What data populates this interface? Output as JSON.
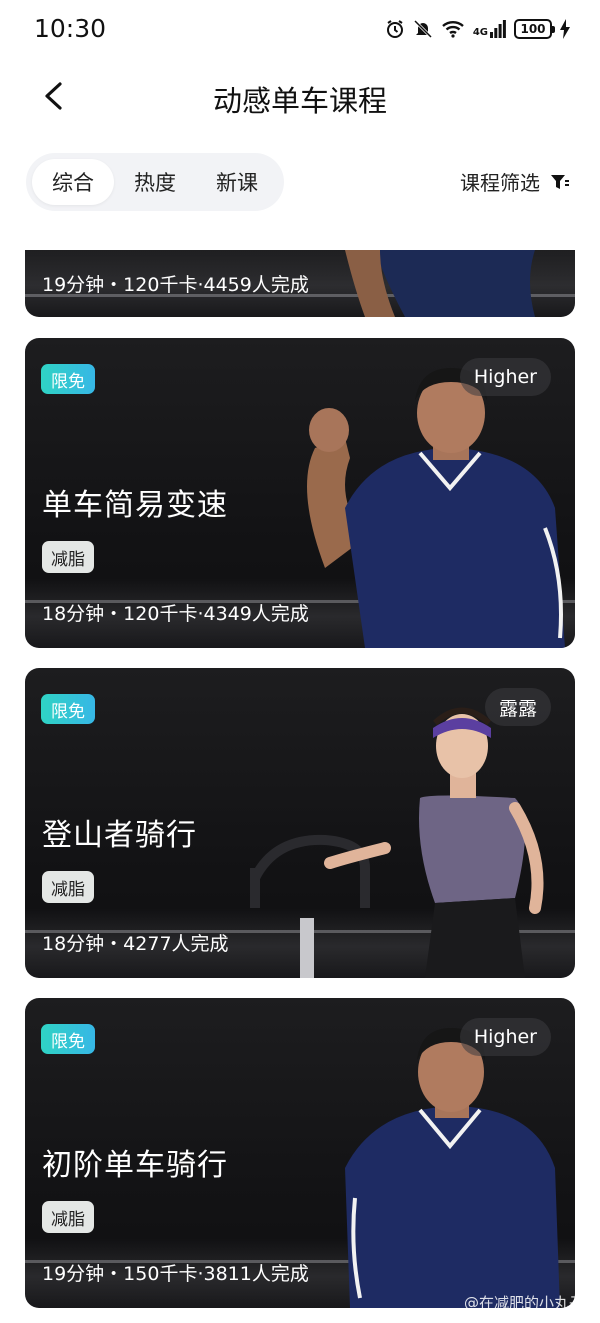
{
  "status_bar": {
    "time": "10:30",
    "battery": "100",
    "network": "4G"
  },
  "header": {
    "title": "动感单车课程"
  },
  "tabs": [
    {
      "label": "综合",
      "active": true
    },
    {
      "label": "热度",
      "active": false
    },
    {
      "label": "新课",
      "active": false
    }
  ],
  "filter": {
    "label": "课程筛选"
  },
  "cards": [
    {
      "meta": "19分钟・120千卡·4459人完成"
    },
    {
      "badge": "限免",
      "coach": "Higher",
      "title": "单车简易变速",
      "tag": "减脂",
      "meta": "18分钟・120千卡·4349人完成"
    },
    {
      "badge": "限免",
      "coach": "露露",
      "title": "登山者骑行",
      "tag": "减脂",
      "meta": "18分钟・4277人完成"
    },
    {
      "badge": "限免",
      "coach": "Higher",
      "title": "初阶单车骑行",
      "tag": "减脂",
      "meta": "19分钟・150千卡·3811人完成"
    }
  ],
  "watermark": "@在减肥的小丸子",
  "colors": {
    "accent_badge_start": "#2fd3c4",
    "accent_badge_end": "#37b7e6",
    "card_bg": "#151517"
  }
}
